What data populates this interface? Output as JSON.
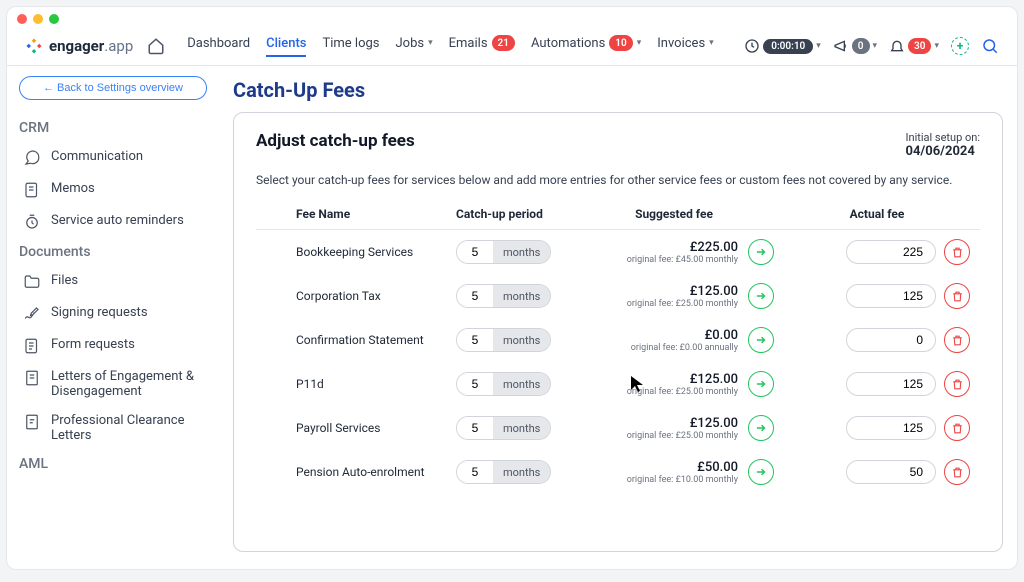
{
  "brand": {
    "name": "engager",
    "suffix": ".app"
  },
  "nav": {
    "items": [
      {
        "label": "Dashboard",
        "badge": null
      },
      {
        "label": "Clients",
        "badge": null,
        "active": true
      },
      {
        "label": "Time logs",
        "badge": null
      },
      {
        "label": "Jobs",
        "badge": null,
        "caret": true
      },
      {
        "label": "Emails",
        "badge": "21"
      },
      {
        "label": "Automations",
        "badge": "10",
        "caret": true
      },
      {
        "label": "Invoices",
        "badge": null,
        "caret": true
      }
    ],
    "timer": "0:00:10",
    "announce_badge": "0",
    "bell_badge": "30"
  },
  "sidebar": {
    "back": "← Back to Settings overview",
    "sections": [
      {
        "title": "CRM",
        "items": [
          "Communication",
          "Memos",
          "Service auto reminders"
        ]
      },
      {
        "title": "Documents",
        "items": [
          "Files",
          "Signing requests",
          "Form requests",
          "Letters of Engagement & Disengagement",
          "Professional Clearance Letters"
        ]
      },
      {
        "title": "AML",
        "items": []
      }
    ]
  },
  "page": {
    "title": "Catch-Up Fees",
    "card_title": "Adjust catch-up fees",
    "setup_label": "Initial setup on:",
    "setup_date": "04/06/2024",
    "description": "Select your catch-up fees for services below and add more entries for other service fees or custom fees not covered by any service.",
    "headers": {
      "name": "Fee Name",
      "period": "Catch-up period",
      "suggested": "Suggested fee",
      "actual": "Actual fee"
    },
    "unit": "months",
    "rows": [
      {
        "name": "Bookkeeping Services",
        "period": "5",
        "suggested": "£225.00",
        "original": "original fee: £45.00 monthly",
        "actual": "225"
      },
      {
        "name": "Corporation Tax",
        "period": "5",
        "suggested": "£125.00",
        "original": "original fee: £25.00 monthly",
        "actual": "125"
      },
      {
        "name": "Confirmation Statement",
        "period": "5",
        "suggested": "£0.00",
        "original": "original fee: £0.00 annually",
        "actual": "0"
      },
      {
        "name": "P11d",
        "period": "5",
        "suggested": "£125.00",
        "original": "original fee: £25.00 monthly",
        "actual": "125"
      },
      {
        "name": "Payroll Services",
        "period": "5",
        "suggested": "£125.00",
        "original": "original fee: £25.00 monthly",
        "actual": "125"
      },
      {
        "name": "Pension Auto-enrolment",
        "period": "5",
        "suggested": "£50.00",
        "original": "original fee: £10.00 monthly",
        "actual": "50"
      }
    ]
  }
}
